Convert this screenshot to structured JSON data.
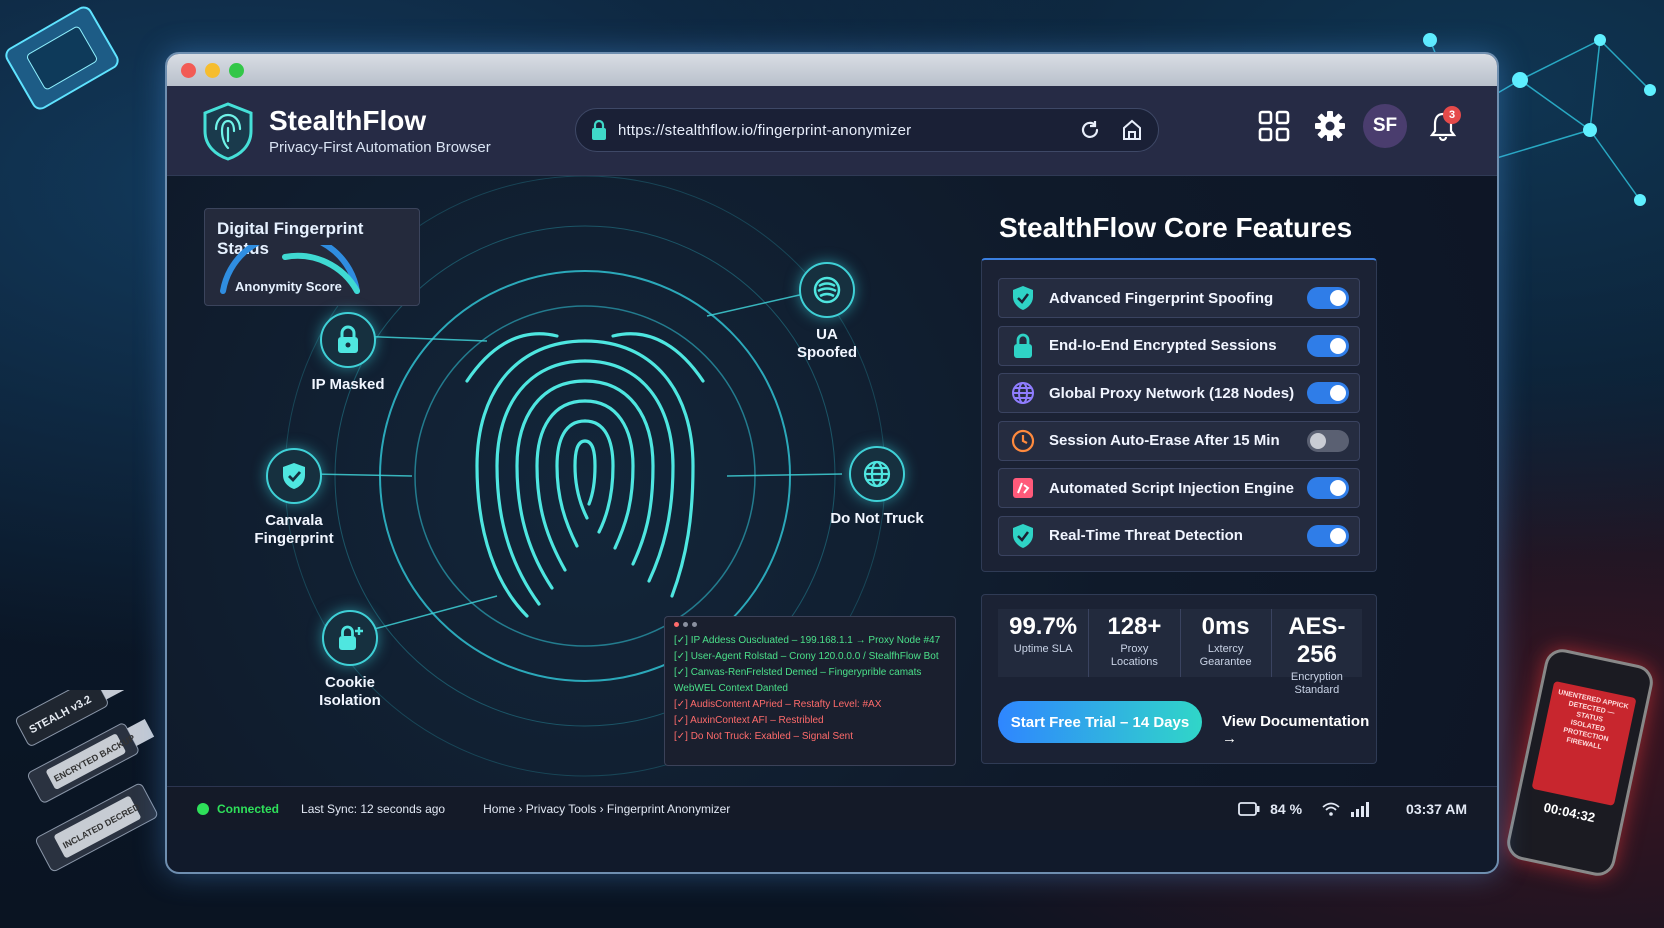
{
  "window": {
    "controls": {
      "close_color": "#f25b55",
      "minimize_color": "#f6bd2f",
      "maximize_color": "#33c748"
    }
  },
  "header": {
    "brand_name": "StealthFlow",
    "brand_subtitle": "Privacy-First Automation Browser",
    "url": "https://stealthflow.io/fingerprint-anonymizer",
    "avatar_initials": "SF",
    "notification_count": "3",
    "icons": [
      "shield-logo-icon",
      "lock-icon",
      "reload-icon",
      "bookmark-icon",
      "grid-icon",
      "gear-icon",
      "bell-icon"
    ]
  },
  "fingerprint_status": {
    "title": "Digital Fingerprint Status",
    "score_label": "Anonymity Score"
  },
  "nodes": [
    {
      "label": "IP Masked",
      "icon": "lock-icon"
    },
    {
      "label": "UA\nSpoofed",
      "icon": "ua-icon"
    },
    {
      "label": "Canvala\nFingerprint",
      "icon": "shield-check-icon"
    },
    {
      "label": "Do Not Truck",
      "icon": "globe-icon"
    },
    {
      "label": "Cookie\nIsolation",
      "icon": "cookie-lock-icon"
    }
  ],
  "terminal": {
    "lines": [
      {
        "text": "[✓] IP Addess Ouscluated – 199.168.1.1 → Proxy Node #47",
        "color": "#4be08a"
      },
      {
        "text": "[✓] User-Agent Rolstad – Crony 120.0.0.0 / StealfhFlow Bot",
        "color": "#4be08a"
      },
      {
        "text": "[✓] Canvas-RenFrelsted Demed – Fingeryprible camats",
        "color": "#4be08a"
      },
      {
        "text": "WebWEL Context Danted",
        "color": "#4be08a"
      },
      {
        "text": "[✓] AudisContent APried – Restafty Level: #AX",
        "color": "#ff6b6b"
      },
      {
        "text": "[✓] AuxinContext AFI – Restribled",
        "color": "#ff6b6b"
      },
      {
        "text": "[✓] Do Not Truck: Exabled – Signal Sent",
        "color": "#ff6b6b"
      }
    ]
  },
  "features": {
    "title": "StealthFlow Core Features",
    "items": [
      {
        "label": "Advanced Fingerprint Spoofing",
        "icon": "shield-check-icon",
        "icon_color": "#2fd3c6",
        "enabled": true
      },
      {
        "label": "End-Io-End Encrypted Sessions",
        "icon": "lock-icon",
        "icon_color": "#2fd3c6",
        "enabled": true
      },
      {
        "label": "Global Proxy Network (128 Nodes)",
        "icon": "globe-icon",
        "icon_color": "#8f7dff",
        "enabled": true
      },
      {
        "label": "Session Auto-Erase After 15 Min",
        "icon": "clock-icon",
        "icon_color": "#ff8a3d",
        "enabled": false
      },
      {
        "label": "Automated Script Injection Engine",
        "icon": "script-icon",
        "icon_color": "#ff5a7a",
        "enabled": true
      },
      {
        "label": "Real-Time Threat Detection",
        "icon": "shield-check-icon",
        "icon_color": "#2fd3c6",
        "enabled": true
      }
    ]
  },
  "stats": [
    {
      "value": "99.7%",
      "label": "Uptime SLA"
    },
    {
      "value": "128+",
      "label": "Proxy\nLocations"
    },
    {
      "value": "0ms",
      "label": "Lxtercy\nGearantee"
    },
    {
      "value": "AES-256",
      "label": "Encryption\nStandard"
    }
  ],
  "cta": {
    "primary": "Start Free Trial – 14 Days",
    "secondary": "View Documentation →"
  },
  "statusbar": {
    "connection": "Connected",
    "connection_color": "#2ee05a",
    "last_sync": "Last Sync: 12 seconds ago",
    "breadcrumb": "Home › Privacy Tools › Fingerprint Anonymizer",
    "battery": "84 %",
    "time": "03:37 AM"
  },
  "background": {
    "usb_labels": [
      "STEALH v3.2",
      "ENCRYTED BACKUP",
      "INCLATED DECRED"
    ],
    "phone_text": "UNENTERED APPICK\nDETECTED —\nSTATUS\nISOLATED\nPROTECTION\nFIREWALL",
    "phone_timer": "00:04:32"
  }
}
